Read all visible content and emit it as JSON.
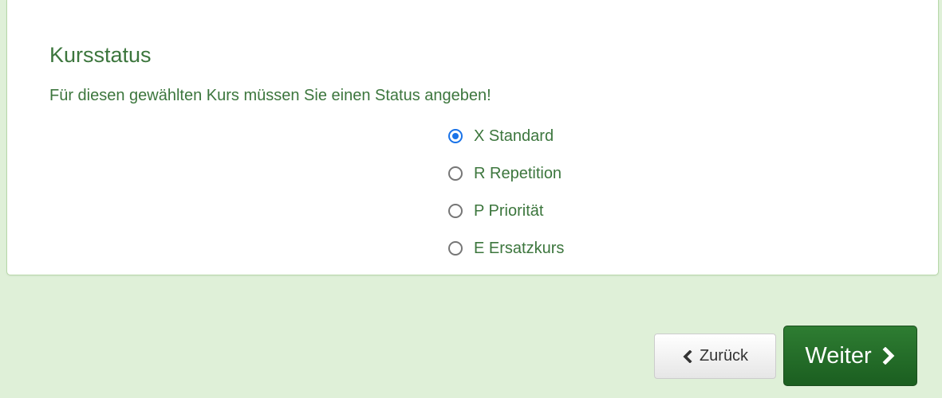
{
  "card": {
    "title": "Kursstatus",
    "instruction": "Für diesen gewählten Kurs müssen Sie einen Status angeben!"
  },
  "status_options": [
    {
      "label": "X Standard",
      "checked": true
    },
    {
      "label": "R Repetition",
      "checked": false
    },
    {
      "label": "P Priorität",
      "checked": false
    },
    {
      "label": "E Ersatzkurs",
      "checked": false
    }
  ],
  "buttons": {
    "back_label": "Zurück",
    "back_icon": "chevron-left-icon",
    "next_label": "Weiter",
    "next_icon": "chevron-right-icon"
  },
  "colors": {
    "page_background": "#dff0d8",
    "text_green": "#3c763d",
    "radio_selected": "#1a73e8",
    "next_button": "#1b5e20"
  }
}
